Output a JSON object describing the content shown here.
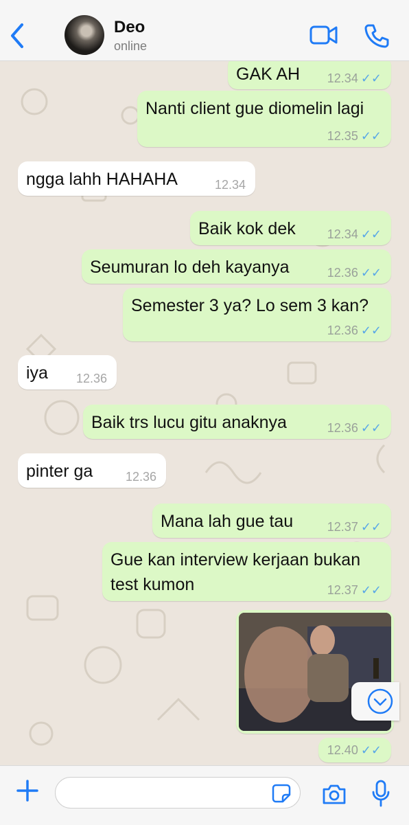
{
  "header": {
    "contact_name": "Deo",
    "status": "online",
    "icons": {
      "back": "chevron-left-icon",
      "video": "video-call-icon",
      "call": "phone-icon"
    }
  },
  "colors": {
    "accent": "#1f7bf6",
    "outgoing_bubble": "#dcf8c6",
    "incoming_bubble": "#ffffff",
    "chat_background": "#ece5dd",
    "read_ticks": "#58a7e7"
  },
  "messages": [
    {
      "direction": "outgoing",
      "text": "GAK AH",
      "time": "12.34",
      "read": true
    },
    {
      "direction": "outgoing",
      "text": "Nanti client gue diomelin lagi",
      "time": "12.35",
      "read": true
    },
    {
      "direction": "incoming",
      "text": "ngga lahh HAHAHA",
      "time": "12.34"
    },
    {
      "direction": "outgoing",
      "text": "Baik kok dek",
      "time": "12.34",
      "read": true
    },
    {
      "direction": "outgoing",
      "text": "Seumuran lo deh kayanya",
      "time": "12.36",
      "read": true
    },
    {
      "direction": "outgoing",
      "text": "Semester 3 ya? Lo sem 3 kan?",
      "time": "12.36",
      "read": true
    },
    {
      "direction": "incoming",
      "text": "iya",
      "time": "12.36"
    },
    {
      "direction": "outgoing",
      "text": "Baik trs lucu gitu anaknya",
      "time": "12.36",
      "read": true
    },
    {
      "direction": "incoming",
      "text": "pinter ga",
      "time": "12.36"
    },
    {
      "direction": "outgoing",
      "text": "Mana lah gue tau",
      "time": "12.37",
      "read": true
    },
    {
      "direction": "outgoing",
      "text": "Gue kan interview kerjaan bukan test kumon",
      "time": "12.37",
      "read": true
    },
    {
      "direction": "outgoing",
      "type": "image",
      "content": "reaction image of a man sitting on a couch",
      "time": "12.40",
      "read": true
    }
  ],
  "composer": {
    "placeholder": "",
    "icons": {
      "add": "plus-icon",
      "sticker": "sticker-icon",
      "camera": "camera-icon",
      "mic": "microphone-icon"
    }
  },
  "scroll_down_icon": "chevron-down-circle-icon"
}
